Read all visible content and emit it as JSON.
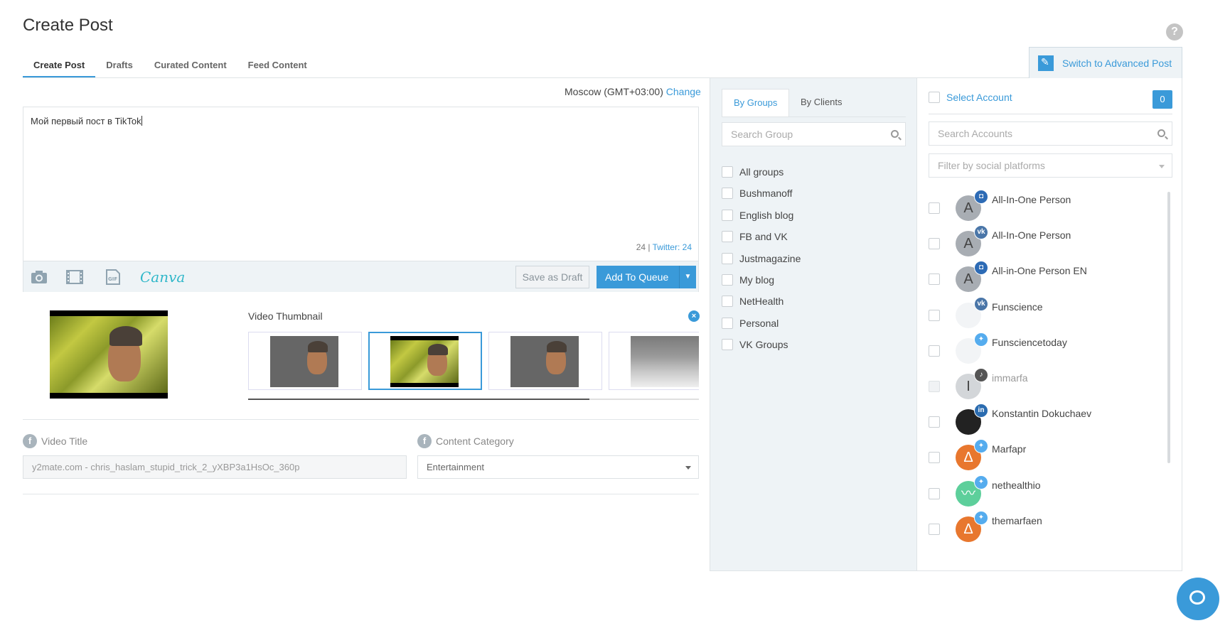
{
  "page": {
    "title": "Create Post",
    "help": "?"
  },
  "tabs": [
    "Create Post",
    "Drafts",
    "Curated Content",
    "Feed Content"
  ],
  "advanced_button": "Switch to Advanced Post",
  "timezone": {
    "label": "Moscow (GMT+03:00)",
    "change": "Change"
  },
  "editor": {
    "text": "Мой первый пост в TikTok",
    "count": "24 |",
    "twitter_count": "Twitter: 24",
    "canva": "Canva",
    "save_draft": "Save as Draft",
    "add_queue": "Add To Queue"
  },
  "video": {
    "thumbnail_label": "Video Thumbnail",
    "title_label": "Video Title",
    "title_value": "y2mate.com - chris_haslam_stupid_trick_2_yXBP3a1HsOc_360p",
    "category_label": "Content Category",
    "category_value": "Entertainment",
    "selected_thumbnail": 2
  },
  "groups": {
    "tab_groups": "By Groups",
    "tab_clients": "By Clients",
    "search_placeholder": "Search Group",
    "items": [
      "All groups",
      "Bushmanoff",
      "English blog",
      "FB and VK",
      "Justmagazine",
      "My blog",
      "NetHealth",
      "Personal",
      "VK Groups"
    ]
  },
  "accounts": {
    "select_label": "Select Account",
    "count": "0",
    "search_placeholder": "Search Accounts",
    "filter_placeholder": "Filter by social platforms",
    "items": [
      {
        "name": "All-In-One Person",
        "avatar": "A",
        "network": "instagram",
        "badge_color": "#2d6bb5",
        "avatar_color": "#a8adb3",
        "disabled": false
      },
      {
        "name": "All-In-One Person",
        "avatar": "A",
        "network": "vk",
        "badge_color": "#4a76a8",
        "avatar_color": "#a8adb3",
        "disabled": false
      },
      {
        "name": "All-in-One Person EN",
        "avatar": "A",
        "network": "instagram",
        "badge_color": "#2d6bb5",
        "avatar_color": "#a8adb3",
        "disabled": false
      },
      {
        "name": "Funscience",
        "avatar": "",
        "network": "vk",
        "badge_color": "#4a76a8",
        "avatar_color": "#f2f4f6",
        "disabled": false
      },
      {
        "name": "Funsciencetoday",
        "avatar": "",
        "network": "twitter",
        "badge_color": "#55acee",
        "avatar_color": "#f2f4f6",
        "disabled": false
      },
      {
        "name": "immarfa",
        "avatar": "I",
        "network": "tiktok",
        "badge_color": "#555555",
        "avatar_color": "#d3d6d9",
        "disabled": true
      },
      {
        "name": "Konstantin Dokuchaev",
        "avatar": "",
        "network": "linkedin",
        "badge_color": "#2b6cb0",
        "avatar_color": "#222222",
        "disabled": false
      },
      {
        "name": "Marfapr",
        "avatar": "Δ",
        "network": "twitter",
        "badge_color": "#55acee",
        "avatar_color": "#e8772e",
        "disabled": false
      },
      {
        "name": "nethealthio",
        "avatar": "〰",
        "network": "twitter",
        "badge_color": "#55acee",
        "avatar_color": "#5dcf9b",
        "disabled": false
      },
      {
        "name": "themarfaen",
        "avatar": "Δ",
        "network": "twitter",
        "badge_color": "#55acee",
        "avatar_color": "#e8772e",
        "disabled": false
      }
    ]
  }
}
